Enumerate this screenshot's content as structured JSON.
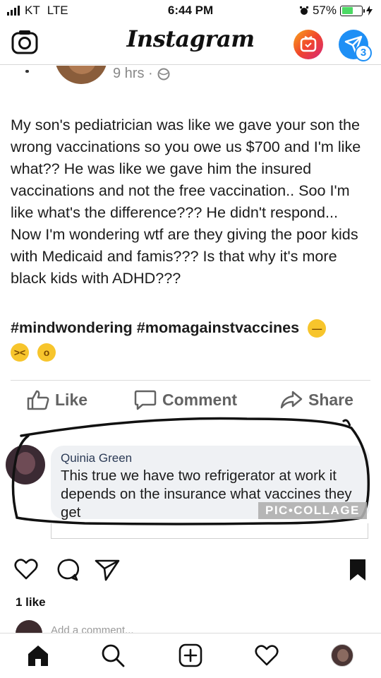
{
  "status_bar": {
    "carrier": "KT",
    "network": "LTE",
    "time": "6:44 PM",
    "battery": "57%",
    "battery_level": 0.57
  },
  "header": {
    "app_name": "Instagram",
    "direct_badge_count": "3",
    "colors": {
      "igtv_start": "#f9a61c",
      "igtv_end": "#d6267a",
      "direct": "#1e8ff5"
    }
  },
  "embedded_post": {
    "time": "9 hrs ·",
    "text": "My son's pediatrician was like we gave your son the wrong vaccinations so you owe us $700 and I'm like what?? He was like we gave him the insured vaccinations and not the free vaccination.. Soo I'm like what's the difference??? He didn't respond... Now I'm wondering wtf are they giving the poor kids with Medicaid and famis??? Is that why it's more black kids with ADHD???",
    "hashtags": "#mindwondering #momagainstvaccines",
    "actions": {
      "like": "Like",
      "comment": "Comment",
      "share": "Share"
    },
    "comment": {
      "author": "Quinia Green",
      "text": "This true we have two refrigerator at work it depends on the insurance what vaccines they get"
    },
    "watermark": "PIC•COLLAGE"
  },
  "post_footer": {
    "likes": "1 like",
    "add_comment_placeholder": "Add a comment..."
  },
  "icons": {
    "header": [
      "camera-icon",
      "igtv-icon",
      "direct-message-icon"
    ],
    "post_actions": [
      "heart-icon",
      "comment-icon",
      "share-icon",
      "bookmark-icon"
    ],
    "bottom_nav": [
      "home-icon",
      "search-icon",
      "new-post-icon",
      "activity-heart-icon",
      "profile-avatar"
    ]
  }
}
